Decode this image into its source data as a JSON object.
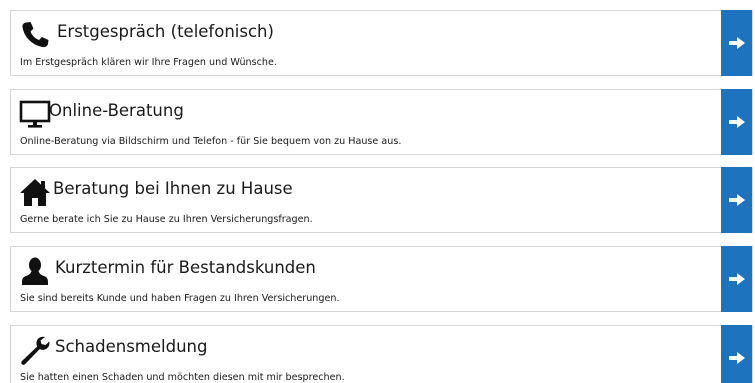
{
  "items": [
    {
      "icon": "phone-icon",
      "title": "Erstgespräch (telefonisch)",
      "description": "Im Erstgespräch klären wir Ihre Fragen und Wünsche."
    },
    {
      "icon": "monitor-icon",
      "title": "Online-Beratung",
      "description": "Online-Beratung via Bildschirm und Telefon - für Sie bequem von zu Hause aus."
    },
    {
      "icon": "home-icon",
      "title": "Beratung bei Ihnen zu Hause",
      "description": "Gerne berate ich Sie zu Hause zu Ihren Versicherungsfragen."
    },
    {
      "icon": "user-icon",
      "title": "Kurztermin für Bestandskunden",
      "description": "Sie sind bereits Kunde und haben Fragen zu Ihren Versicherungen."
    },
    {
      "icon": "wrench-icon",
      "title": "Schadensmeldung",
      "description": "Sie hatten einen Schaden und möchten diesen mit mir besprechen."
    }
  ],
  "colors": {
    "accent": "#1e73be",
    "border": "#d7d7d7",
    "text": "#1a1a1a"
  },
  "arrow_icon": "arrow-right-icon"
}
